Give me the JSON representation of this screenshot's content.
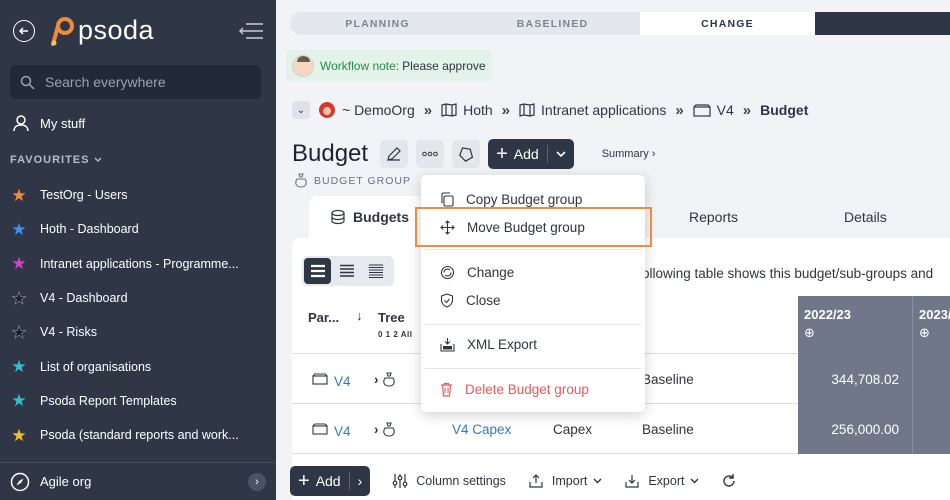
{
  "sidebar": {
    "logo": "psoda",
    "search_placeholder": "Search everywhere",
    "my_stuff": "My stuff",
    "favourites_label": "FAVOURITES",
    "favourites": [
      {
        "label": "TestOrg - Users",
        "star_color": "#f08a3c"
      },
      {
        "label": "Hoth - Dashboard",
        "star_color": "#3d8ff0"
      },
      {
        "label": "Intranet applications - Programme...",
        "star_color": "#d43fd0"
      },
      {
        "label": "V4 - Dashboard",
        "star_color": "#1a1f29"
      },
      {
        "label": "V4 - Risks",
        "star_color": "#1a1f29"
      },
      {
        "label": "List of organisations",
        "star_color": "#2fc0d0"
      },
      {
        "label": "Psoda Report Templates",
        "star_color": "#2fc0d0"
      },
      {
        "label": "Psoda (standard reports and work...",
        "star_color": "#f0c030"
      }
    ],
    "org_label": "Agile org"
  },
  "phases": [
    "PLANNING",
    "BASELINED",
    "CHANGE"
  ],
  "workflow": {
    "label": "Workflow note:",
    "text": "Please approve"
  },
  "breadcrumb": {
    "org": "~ DemoOrg",
    "items": [
      "Hoth",
      "Intranet applications",
      "V4"
    ],
    "current": "Budget"
  },
  "page": {
    "title": "Budget",
    "subtitle": "BUDGET GROUP",
    "add_label": "Add",
    "summary_label": "Summary ›"
  },
  "tabs": {
    "budgets": "Budgets",
    "reports": "Reports",
    "details": "Details"
  },
  "panel": {
    "description": "ollowing table shows this budget/sub-groups and"
  },
  "table": {
    "headers": {
      "par": "Par...",
      "tree": "Tree",
      "tree_levels": "0 1 2 All"
    },
    "years": [
      "2022/23",
      "2023/"
    ],
    "year_plus": "⊕",
    "rows": [
      {
        "par": "V4",
        "name": "",
        "type": "",
        "status": "Baseline",
        "value": "344,708.02"
      },
      {
        "par": "V4",
        "name": "V4 Capex",
        "type": "Capex",
        "status": "Baseline",
        "value": "256,000.00"
      }
    ]
  },
  "footer": {
    "add_label": "Add",
    "column_settings": "Column settings",
    "import": "Import",
    "export": "Export"
  },
  "menu": {
    "copy": "Copy Budget group",
    "move": "Move Budget group",
    "change": "Change",
    "close": "Close",
    "xml_export": "XML Export",
    "delete": "Delete Budget group"
  },
  "colors": {
    "sidebar": "#2f3747",
    "accent_orange": "#f08a3c",
    "danger": "#e55a5a",
    "link": "#2e7bbd",
    "workflow_bg": "#e3f3ea"
  }
}
